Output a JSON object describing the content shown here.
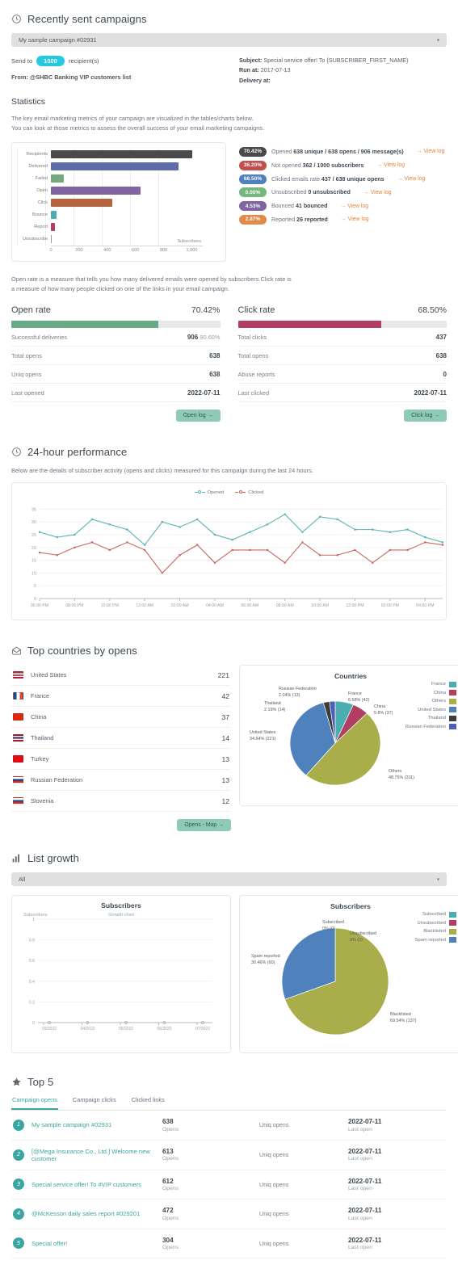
{
  "recent": {
    "title": "Recently sent campaigns",
    "icon": "clock-icon",
    "campaign_select_value": "My sample campaign #02931",
    "send_to_prefix": "Send to",
    "send_to_count": "1000",
    "send_to_suffix": "recipient(s)",
    "from_label": "From:",
    "from_value": "@SHBC Banking VIP customers list",
    "subject_label": "Subject:",
    "subject_value": "Special service offer! To {SUBSCRIBER_FIRST_NAME}",
    "run_at_label": "Run at:",
    "run_at_value": "2017-07-13",
    "delivery_at_label": "Delivery at:",
    "delivery_at_value": ""
  },
  "statistics": {
    "title": "Statistics",
    "desc_line1": "The key email marketing metrics of your campaign are visualized in the tables/charts below.",
    "desc_line2": "You can look at those metrics to assess the overall success of your email marketing campaigns.",
    "view_log_label": "View log",
    "rows": [
      {
        "pct": "70.42%",
        "color": "#4a4a4a",
        "label": "Opened",
        "value": "638 unique / 638 opens / 906 message(s)",
        "has_log": true
      },
      {
        "pct": "36.20%",
        "color": "#c0504d",
        "label": "Not opened",
        "value": "362 / 1000 subscribers",
        "has_log": true
      },
      {
        "pct": "68.50%",
        "color": "#4f81bd",
        "label": "Clicked emails rate",
        "value": "437 / 638 unique opens",
        "has_log": true
      },
      {
        "pct": "0.00%",
        "color": "#77b57e",
        "label": "Unsubscribed",
        "value": "0 unsubscribed",
        "has_log": true
      },
      {
        "pct": "4.53%",
        "color": "#8064a2",
        "label": "Bounced",
        "value": "41 bounced",
        "has_log": true
      },
      {
        "pct": "2.87%",
        "color": "#e08b4c",
        "label": "Reported",
        "value": "26 reported",
        "has_log": true
      }
    ]
  },
  "rate_desc_line1": "Open rate is a measure that tells you how many delivered emails were opened by subscribers.Click rate is",
  "rate_desc_line2": "a measure of how many people clicked on one of the links in your email campaign.",
  "open_rate": {
    "title": "Open rate",
    "pct": "70.42%",
    "pct_num": 70.42,
    "color": "#6aab87",
    "rows": [
      {
        "key": "Successful deliveries",
        "value": "906",
        "extra": "90.60%"
      },
      {
        "key": "Total opens",
        "value": "638",
        "extra": ""
      },
      {
        "key": "Uniq opens",
        "value": "638",
        "extra": ""
      },
      {
        "key": "Last opened",
        "value": "2022-07-11",
        "extra": ""
      }
    ],
    "button": "Open log →"
  },
  "click_rate": {
    "title": "Click rate",
    "pct": "68.50%",
    "pct_num": 68.5,
    "color": "#b23f62",
    "rows": [
      {
        "key": "Total clicks",
        "value": "437",
        "extra": ""
      },
      {
        "key": "Total opens",
        "value": "638",
        "extra": ""
      },
      {
        "key": "Abuse reports",
        "value": "0",
        "extra": ""
      },
      {
        "key": "Last clicked",
        "value": "2022-07-11",
        "extra": ""
      }
    ],
    "button": "Click log →"
  },
  "performance": {
    "title": "24-hour performance",
    "icon": "clock-icon",
    "desc": "Below are the details of subscriber activity (opens and clicks) measured for this campaign during the last 24 hours."
  },
  "countries_section": {
    "title": "Top countries by opens",
    "icon": "envelope-open-icon",
    "map_button": "Opens - Map →",
    "rows": [
      {
        "flag": "us",
        "name": "United States",
        "value": "221"
      },
      {
        "flag": "fr",
        "name": "France",
        "value": "42"
      },
      {
        "flag": "cn",
        "name": "China",
        "value": "37"
      },
      {
        "flag": "th",
        "name": "Thailand",
        "value": "14"
      },
      {
        "flag": "tr",
        "name": "Turkey",
        "value": "13"
      },
      {
        "flag": "ru",
        "name": "Russian Federation",
        "value": "13"
      },
      {
        "flag": "si",
        "name": "Slovenia",
        "value": "12"
      }
    ]
  },
  "list_growth": {
    "title": "List growth",
    "icon": "bar-chart-icon",
    "select_value": "All"
  },
  "top5": {
    "title": "Top 5",
    "icon": "star-icon",
    "tabs": [
      {
        "label": "Campaign opens",
        "active": true
      },
      {
        "label": "Campaign clicks",
        "active": false
      },
      {
        "label": "Clicked links",
        "active": false
      }
    ],
    "rows": [
      {
        "rank": "1",
        "name": "My sample campaign #02931",
        "count": "638",
        "count_label": "Opens",
        "metric": "Uniq opens",
        "date": "2022-07-11",
        "date_label": "Last open"
      },
      {
        "rank": "2",
        "name": "[@Mega Insurance Co., Ltd.] Welcome new customer",
        "count": "613",
        "count_label": "Opens",
        "metric": "Uniq opens",
        "date": "2022-07-11",
        "date_label": "Last open"
      },
      {
        "rank": "3",
        "name": "Special service offer! To #VIP customers",
        "count": "612",
        "count_label": "Opens",
        "metric": "Uniq opens",
        "date": "2022-07-11",
        "date_label": "Last open"
      },
      {
        "rank": "4",
        "name": "@McKesson daily sales report #029201",
        "count": "472",
        "count_label": "Opens",
        "metric": "Uniq opens",
        "date": "2022-07-11",
        "date_label": "Last open"
      },
      {
        "rank": "5",
        "name": "Special offer!",
        "count": "304",
        "count_label": "Opens",
        "metric": "Uniq opens",
        "date": "2022-07-11",
        "date_label": "Last open"
      }
    ]
  },
  "chart_data": [
    {
      "type": "bar",
      "title": "",
      "orientation": "horizontal",
      "categories": [
        "Recipients",
        "Delivered",
        "Failed",
        "Open",
        "Click",
        "Bounce",
        "Report",
        "Unsubscribe"
      ],
      "values": [
        1000,
        906,
        94,
        638,
        437,
        41,
        26,
        0
      ],
      "colors": [
        "#4a4a4a",
        "#5b6ca8",
        "#74a97f",
        "#8064a2",
        "#b5643f",
        "#4aaeb0",
        "#b23f62",
        "#999999"
      ],
      "xlabel": "Subscribers",
      "ylabel": "",
      "xlim": [
        0,
        1100
      ],
      "xticks": [
        0,
        200,
        400,
        600,
        800,
        1000
      ],
      "xticklabels": [
        "0",
        "200",
        "400",
        "600",
        "800",
        "1,000"
      ],
      "grid": true
    },
    {
      "type": "line",
      "title": "24-hour performance",
      "xlabel": "",
      "ylabel": "",
      "ylim": [
        0,
        37
      ],
      "yticks": [
        0,
        5,
        10,
        15,
        20,
        25,
        30,
        35
      ],
      "grid": true,
      "legend_position": "top-center",
      "x": [
        "06:00 PM",
        "07:00 PM",
        "08:00 PM",
        "09:00 PM",
        "10:00 PM",
        "11:00 PM",
        "12:00 AM",
        "01:00 AM",
        "02:00 AM",
        "03:00 AM",
        "04:00 AM",
        "05:00 AM",
        "06:00 AM",
        "07:00 AM",
        "08:00 AM",
        "09:00 AM",
        "10:00 AM",
        "11:00 AM",
        "12:00 PM",
        "01:00 PM",
        "02:00 PM",
        "03:00 PM",
        "04:00 PM",
        "05:00 PM"
      ],
      "xticklabels": [
        "06:00 PM",
        "08:00 PM",
        "10:00 PM",
        "12:00 AM",
        "02:00 AM",
        "04:00 AM",
        "06:00 AM",
        "08:00 AM",
        "10:00 AM",
        "12:00 PM",
        "02:00 PM",
        "04:00 PM"
      ],
      "series": [
        {
          "name": "Opened",
          "color": "#5bb3b3",
          "values": [
            26,
            24,
            25,
            31,
            29,
            27,
            21,
            30,
            28,
            31,
            25,
            23,
            26,
            29,
            33,
            26,
            32,
            31,
            27,
            27,
            26,
            27,
            24,
            22
          ]
        },
        {
          "name": "Clicked",
          "color": "#c9665a",
          "values": [
            18,
            17,
            20,
            22,
            19,
            22,
            19,
            10,
            17,
            21,
            14,
            19,
            19,
            19,
            14,
            22,
            17,
            17,
            19,
            14,
            19,
            19,
            22,
            21
          ]
        }
      ]
    },
    {
      "type": "pie",
      "title": "Countries",
      "legend_position": "right",
      "labels": [
        "France",
        "China",
        "Others",
        "United States",
        "Thailand",
        "Russian Federation"
      ],
      "values": [
        42,
        37,
        311,
        221,
        14,
        13
      ],
      "percents": [
        "6.58%",
        "5.8%",
        "48.75%",
        "34.64%",
        "2.19%",
        "2.04%"
      ],
      "colors": [
        "#4aaeb0",
        "#b23f62",
        "#a9ae4a",
        "#4f81bd",
        "#3d3d3d",
        "#4f5fb8"
      ],
      "annotations": [
        "France 6.58% (42)",
        "China 5.8% (37)",
        "Others 48.75% (311)",
        "United States 34.64% (221)",
        "Thailand 2.19% (14)",
        "Russian Federation 2.04% (13)"
      ]
    },
    {
      "type": "line",
      "title": "Subscribers",
      "subtitle": "Growth chart",
      "ylabel": "Subscribers",
      "ylim": [
        0,
        1
      ],
      "yticks": [
        0,
        0.2,
        0.4,
        0.6,
        0.8,
        1
      ],
      "yticklabels": [
        "0",
        "0.2",
        "0.4",
        "0.6",
        "0.8",
        "1"
      ],
      "x": [
        "03/2022",
        "04/2022",
        "05/2022",
        "06/2022",
        "07/2022"
      ],
      "values": [
        0,
        0,
        0,
        0,
        0
      ],
      "grid": true
    },
    {
      "type": "pie",
      "title": "Subscribers",
      "legend_position": "right",
      "labels": [
        "Subscribed",
        "Unsubscribed",
        "Blacklisted",
        "Spam reported"
      ],
      "values": [
        0,
        0,
        137,
        60
      ],
      "percents": [
        "0%",
        "0%",
        "69.54%",
        "30.46%"
      ],
      "colors": [
        "#4aaeb0",
        "#b23f62",
        "#a9ae4a",
        "#4f81bd"
      ],
      "annotations": [
        "Subscribed 0% (0)",
        "Unsubscribed 0% (0)",
        "Blacklisted 69.54% (137)",
        "Spam reported 30.46% (60)"
      ]
    }
  ]
}
